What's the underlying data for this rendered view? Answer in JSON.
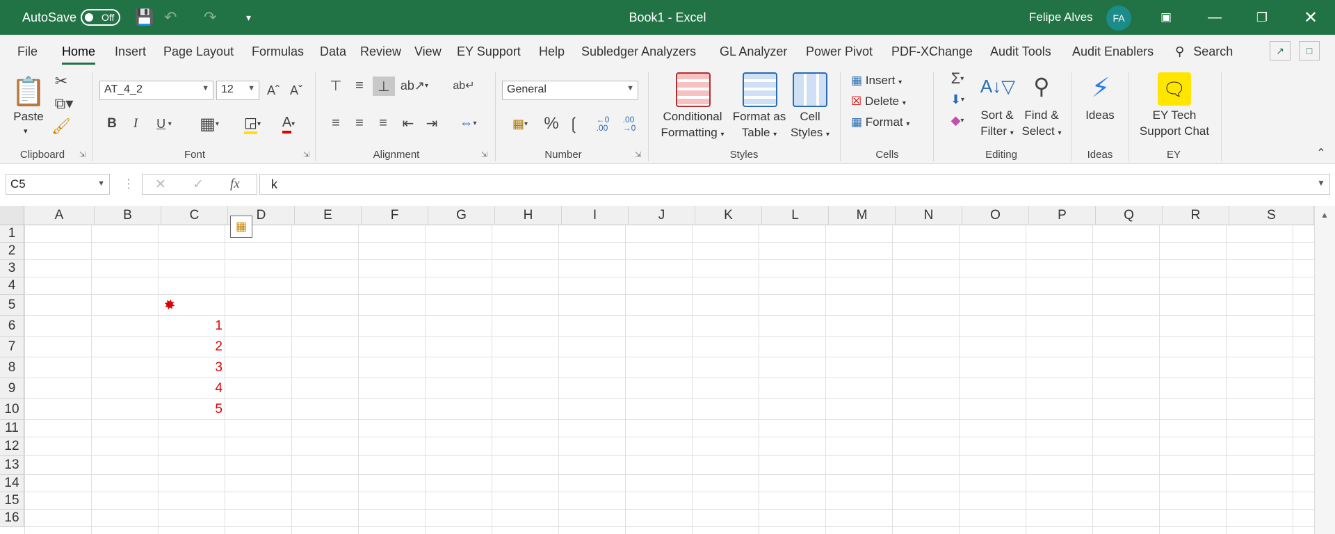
{
  "titlebar": {
    "autosave_label": "AutoSave",
    "autosave_state": "Off",
    "window_title": "Book1  -  Excel",
    "user_name": "Felipe Alves",
    "user_initials": "FA"
  },
  "menu": {
    "tabs": [
      "File",
      "Home",
      "Insert",
      "Page Layout",
      "Formulas",
      "Data",
      "Review",
      "View",
      "EY Support",
      "Help",
      "Subledger Analyzers",
      "GL Analyzer",
      "Power Pivot",
      "PDF-XChange",
      "Audit Tools",
      "Audit Enablers"
    ],
    "active": "Home",
    "search_label": "Search"
  },
  "ribbon": {
    "clipboard": {
      "paste": "Paste",
      "label": "Clipboard"
    },
    "font": {
      "name": "AT_4_2",
      "size": "12",
      "label": "Font"
    },
    "alignment": {
      "label": "Alignment"
    },
    "number": {
      "format": "General",
      "label": "Number"
    },
    "styles": {
      "conditional_1": "Conditional",
      "conditional_2": "Formatting",
      "format_table_1": "Format as",
      "format_table_2": "Table",
      "cell_styles_1": "Cell",
      "cell_styles_2": "Styles",
      "label": "Styles"
    },
    "cells": {
      "insert": "Insert",
      "delete": "Delete",
      "format": "Format",
      "label": "Cells"
    },
    "editing": {
      "sort_1": "Sort &",
      "sort_2": "Filter",
      "find_1": "Find &",
      "find_2": "Select",
      "label": "Editing"
    },
    "ideas": {
      "button": "Ideas",
      "label": "Ideas"
    },
    "ey": {
      "button_1": "EY Tech",
      "button_2": "Support Chat",
      "label": "EY"
    }
  },
  "formula_bar": {
    "name_box": "C5",
    "fx": "fx",
    "value": "k"
  },
  "grid": {
    "columns": [
      "A",
      "B",
      "C",
      "D",
      "E",
      "F",
      "G",
      "H",
      "I",
      "J",
      "K",
      "L",
      "M",
      "N",
      "O",
      "P",
      "Q",
      "R",
      "S"
    ],
    "rows": [
      "1",
      "2",
      "3",
      "4",
      "5",
      "6",
      "7",
      "8",
      "9",
      "10",
      "11",
      "12",
      "13",
      "14",
      "15",
      "16"
    ],
    "c_values": [
      "1",
      "2",
      "3",
      "4",
      "5"
    ],
    "value_color": "#e00000"
  },
  "colors": {
    "accent": "#217346",
    "avatar": "#1b8c89"
  }
}
